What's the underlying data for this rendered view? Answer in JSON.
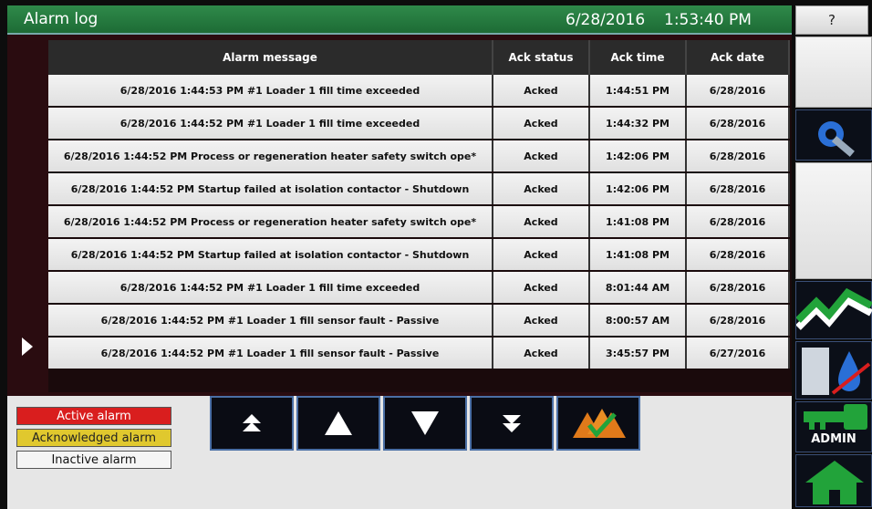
{
  "header": {
    "title": "Alarm log",
    "date": "6/28/2016",
    "time": "1:53:40 PM",
    "help_label": "?"
  },
  "table": {
    "columns": [
      "Alarm message",
      "Ack status",
      "Ack time",
      "Ack date"
    ],
    "rows": [
      [
        "6/28/2016 1:44:53 PM #1 Loader 1 fill time exceeded",
        "Acked",
        "1:44:51 PM",
        "6/28/2016"
      ],
      [
        "6/28/2016 1:44:52 PM #1 Loader 1 fill time exceeded",
        "Acked",
        "1:44:32 PM",
        "6/28/2016"
      ],
      [
        "6/28/2016 1:44:52 PM Process or regeneration heater safety switch ope*",
        "Acked",
        "1:42:06 PM",
        "6/28/2016"
      ],
      [
        "6/28/2016 1:44:52 PM Startup failed at isolation contactor - Shutdown",
        "Acked",
        "1:42:06 PM",
        "6/28/2016"
      ],
      [
        "6/28/2016 1:44:52 PM Process or regeneration heater safety switch ope*",
        "Acked",
        "1:41:08 PM",
        "6/28/2016"
      ],
      [
        "6/28/2016 1:44:52 PM Startup failed at isolation contactor - Shutdown",
        "Acked",
        "1:41:08 PM",
        "6/28/2016"
      ],
      [
        "6/28/2016 1:44:52 PM #1 Loader 1 fill time exceeded",
        "Acked",
        "8:01:44 AM",
        "6/28/2016"
      ],
      [
        "6/28/2016 1:44:52 PM #1 Loader 1 fill sensor fault - Passive",
        "Acked",
        "8:00:57 AM",
        "6/28/2016"
      ],
      [
        "6/28/2016 1:44:52 PM #1 Loader 1 fill sensor fault - Passive",
        "Acked",
        "3:45:57 PM",
        "6/27/2016"
      ]
    ]
  },
  "legend": {
    "active": "Active alarm",
    "acknowledged": "Acknowledged alarm",
    "inactive": "Inactive alarm"
  },
  "nav_buttons": [
    "page-up-icon",
    "arrow-up-icon",
    "arrow-down-icon",
    "page-down-icon",
    "acknowledge-all-icon"
  ],
  "sidebar": {
    "admin_label": "ADMIN",
    "icons": [
      "settings-icon",
      "trend-icon",
      "dryer-icon",
      "key-icon",
      "home-icon"
    ]
  },
  "colors": {
    "title_bar": "#1d6b35",
    "active": "#d91e1e",
    "acknowledged": "#e0c82e",
    "nav_border": "#4a6fa5",
    "accent_blue": "#2a6fd6",
    "accent_green": "#22a33a"
  }
}
